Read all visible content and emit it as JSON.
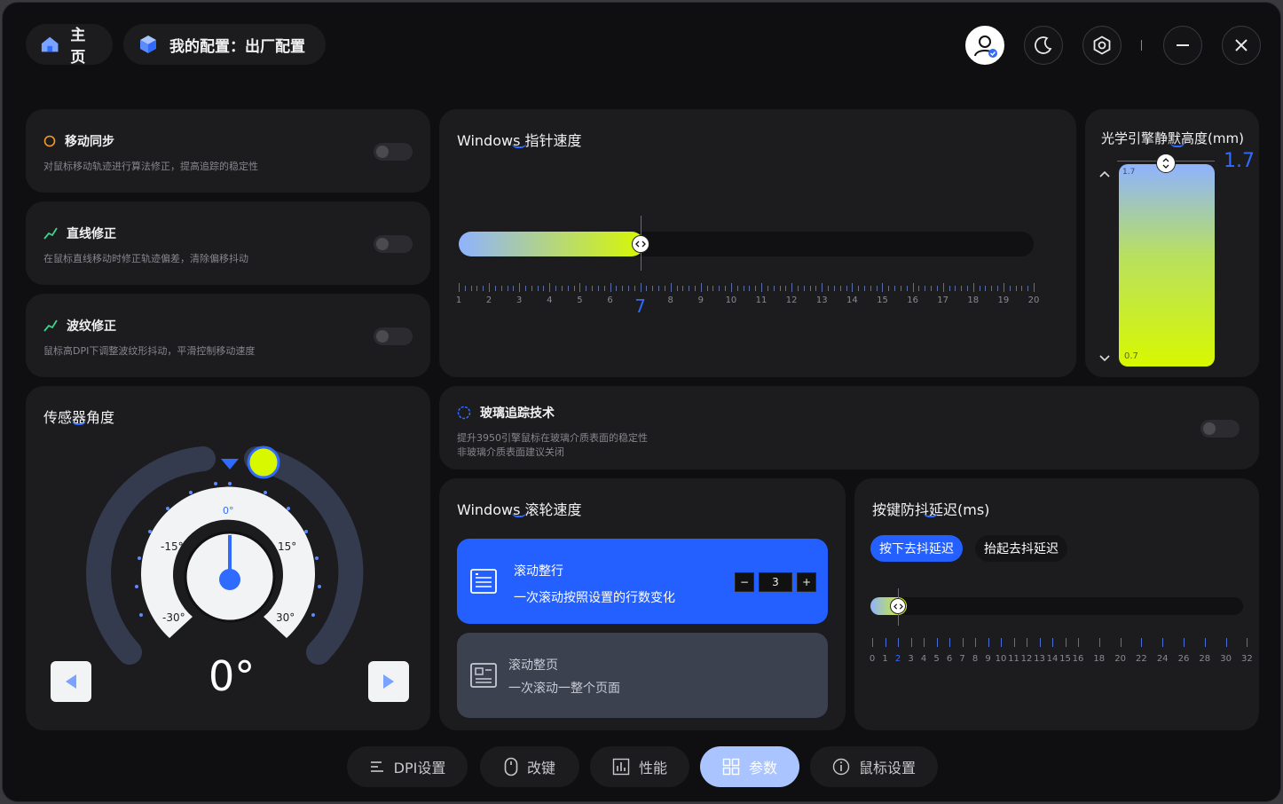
{
  "header": {
    "home_label": "主页",
    "config_label": "我的配置：出厂配置"
  },
  "features": [
    {
      "title": "移动同步",
      "desc": "对鼠标移动轨迹进行算法修正，提高追踪的稳定性",
      "icon": "sync-ring-icon",
      "color": "#f39a2b"
    },
    {
      "title": "直线修正",
      "desc": "在鼠标直线移动时修正轨迹偏差，清除偏移抖动",
      "icon": "line-correct-icon",
      "color": "#3dd48a"
    },
    {
      "title": "波纹修正",
      "desc": "鼠标高DPI下调整波纹形抖动，平滑控制移动速度",
      "icon": "ripple-correct-icon",
      "color": "#3dd48a"
    }
  ],
  "pointer_speed": {
    "title": "Windows 指针速度",
    "value": 7,
    "min": 1,
    "max": 20,
    "ticks": [
      "1",
      "2",
      "3",
      "4",
      "5",
      "6",
      "7",
      "8",
      "9",
      "10",
      "11",
      "12",
      "13",
      "14",
      "15",
      "16",
      "17",
      "18",
      "19",
      "20"
    ]
  },
  "lod": {
    "title": "光学引擎静默高度(mm)",
    "value": "1.7",
    "top_label": "1.7",
    "bottom_label": "0.7"
  },
  "sensor_angle": {
    "title": "传感器角度",
    "value": "0°",
    "marks": {
      "zero": "0°",
      "neg15": "-15°",
      "pos15": "15°",
      "neg30": "-30°",
      "pos30": "30°"
    }
  },
  "glass": {
    "title": "玻璃追踪技术",
    "desc1": "提升3950引擎鼠标在玻璃介质表面的稳定性",
    "desc2": "非玻璃介质表面建议关闭"
  },
  "scroll": {
    "title": "Windows 滚轮速度",
    "line_title": "滚动整行",
    "line_desc": "一次滚动按照设置的行数变化",
    "line_value": "3",
    "minus": "−",
    "plus": "+",
    "page_title": "滚动整页",
    "page_desc": "一次滚动一整个页面"
  },
  "debounce": {
    "title": "按键防抖延迟(ms)",
    "tab_press": "按下去抖延迟",
    "tab_release": "抬起去抖延迟",
    "value": 2,
    "ticks": [
      "0",
      "1",
      "2",
      "3",
      "4",
      "5",
      "6",
      "7",
      "8",
      "9",
      "10",
      "11",
      "12",
      "13",
      "14",
      "15",
      "16",
      "18",
      "20",
      "22",
      "24",
      "26",
      "28",
      "30",
      "32"
    ]
  },
  "nav": {
    "dpi": "DPI设置",
    "remap": "改键",
    "perf": "性能",
    "params": "参数",
    "mouse": "鼠标设置"
  },
  "colors": {
    "accent": "#2f6bff",
    "lime": "#d8f800"
  }
}
